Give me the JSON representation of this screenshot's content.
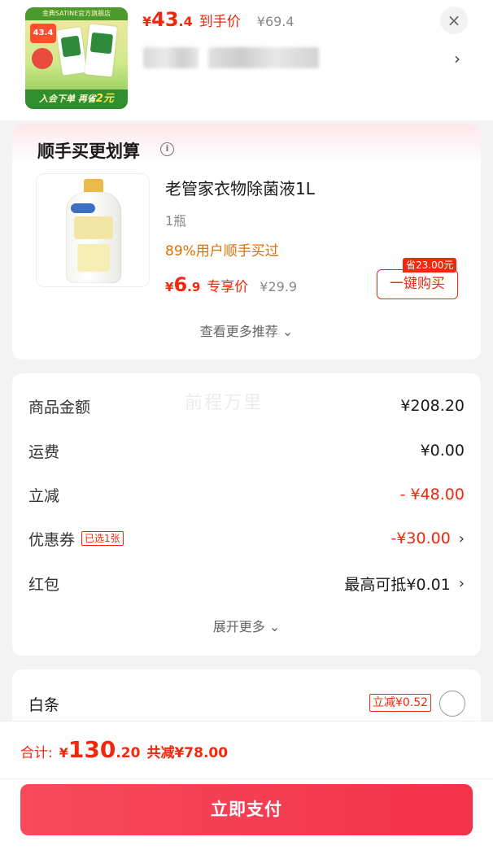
{
  "top_product": {
    "thumb_banner": "金典SATINE官方旗舰店",
    "thumb_price": "43.4",
    "thumb_footer_prefix": "入会下单  再省",
    "thumb_footer_amount": "2元",
    "price_currency": "¥",
    "price_int": "43",
    "price_dec": ".4",
    "price_tag": "到手价",
    "original_price": "¥69.4",
    "close_icon": "×",
    "arrow": "›"
  },
  "recommend": {
    "title": "顺手买更划算",
    "info_icon": "i",
    "item_name": "老管家衣物除菌液1L",
    "item_qty": "1瓶",
    "social_proof": "89%用户顺手买过",
    "price_currency": "¥",
    "price_int": "6",
    "price_dec": ".9",
    "price_tag": "专享价",
    "original_price": "¥29.9",
    "save_badge": "省23.00元",
    "buy_button": "一键购买",
    "more_link": "查看更多推荐 ⌄"
  },
  "summary": {
    "watermark": "前程万里",
    "rows": [
      {
        "label": "商品金额",
        "value": "¥208.20"
      },
      {
        "label": "运费",
        "value": "¥0.00"
      },
      {
        "label": "立减",
        "value": "- ¥48.00"
      },
      {
        "label": "优惠券",
        "tag": "已选1张",
        "value": "-¥30.00",
        "chevron": "›"
      },
      {
        "label": "红包",
        "value": "最高可抵¥0.01",
        "chevron": "›"
      }
    ],
    "expand_link": "展开更多 ⌄"
  },
  "payment": {
    "method_label": "白条",
    "promo": "立减¥0.52"
  },
  "bottom_bar": {
    "total_label": "合计:",
    "total_currency": "¥",
    "total_int": "130",
    "total_dec": ".20",
    "total_discount": "共减¥78.00",
    "pay_button": "立即支付"
  },
  "colors": {
    "accent_red": "#f2270c",
    "pay_button": "#f2324a",
    "social_orange": "#e07000"
  }
}
